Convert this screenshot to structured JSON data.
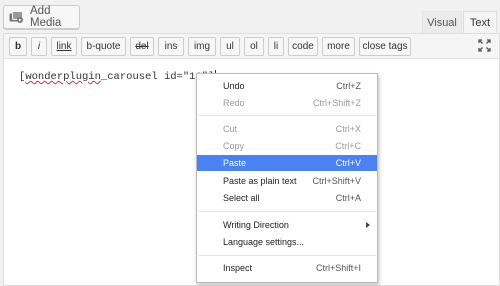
{
  "media": {
    "add_label": "Add Media",
    "icon": "media-icon"
  },
  "tabs": {
    "visual": "Visual",
    "text": "Text"
  },
  "toolbar": {
    "buttons": [
      "b",
      "i",
      "link",
      "b-quote",
      "del",
      "ins",
      "img",
      "ul",
      "ol",
      "li",
      "code",
      "more",
      "close tags"
    ],
    "fullscreen_icon": "fullscreen-icon"
  },
  "editor": {
    "shortcode_open": "[",
    "shortcode_name": "wonderplugin",
    "shortcode_rest": "_carousel id=\"11\"]"
  },
  "context_menu": {
    "items": [
      {
        "label": "Undo",
        "shortcut": "Ctrl+Z",
        "disabled": false
      },
      {
        "label": "Redo",
        "shortcut": "Ctrl+Shift+Z",
        "disabled": true
      },
      {
        "label": "Cut",
        "shortcut": "Ctrl+X",
        "disabled": true
      },
      {
        "label": "Copy",
        "shortcut": "Ctrl+C",
        "disabled": true
      },
      {
        "label": "Paste",
        "shortcut": "Ctrl+V",
        "highlighted": true
      },
      {
        "label": "Paste as plain text",
        "shortcut": "Ctrl+Shift+V"
      },
      {
        "label": "Select all",
        "shortcut": "Ctrl+A"
      },
      {
        "label": "Writing Direction",
        "submenu": true
      },
      {
        "label": "Language settings..."
      },
      {
        "label": "Inspect",
        "shortcut": "Ctrl+Shift+I"
      }
    ],
    "highlight_color": "#4a82f4"
  }
}
